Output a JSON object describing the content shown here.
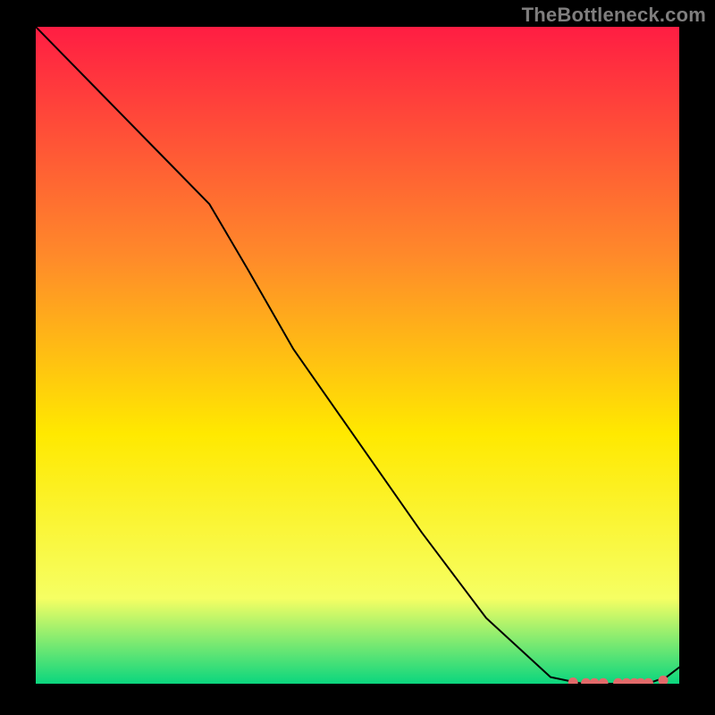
{
  "watermark": "TheBottleneck.com",
  "chart_data": {
    "type": "line",
    "title": "",
    "xlabel": "",
    "ylabel": "",
    "xlim": [
      0,
      100
    ],
    "ylim": [
      0,
      100
    ],
    "grid": false,
    "legend": false,
    "background_gradient": {
      "top": "#ff1d43",
      "mid_upper": "#ff8a2a",
      "mid": "#ffe900",
      "mid_lower": "#f6ff63",
      "bottom": "#0bd67e"
    },
    "series": [
      {
        "name": "bottleneck-curve",
        "type": "line",
        "color": "#000000",
        "stroke_width": 2,
        "x": [
          0,
          10,
          20,
          27,
          33,
          40,
          50,
          60,
          70,
          80,
          85,
          88,
          92,
          95,
          98,
          100
        ],
        "y": [
          100,
          90,
          80,
          73,
          63,
          51,
          37,
          23,
          10,
          1,
          0,
          0,
          0,
          0,
          1,
          2.5
        ]
      },
      {
        "name": "optimum-range-markers",
        "type": "scatter",
        "color": "#e26a6a",
        "marker_radius": 5.5,
        "x": [
          83.5,
          85.5,
          86.8,
          88.2,
          90.5,
          91.8,
          93.0,
          94.0,
          95.2,
          97.5
        ],
        "y": [
          0.2,
          0.1,
          0.1,
          0.1,
          0.1,
          0.1,
          0.1,
          0.1,
          0.1,
          0.5
        ]
      }
    ]
  }
}
